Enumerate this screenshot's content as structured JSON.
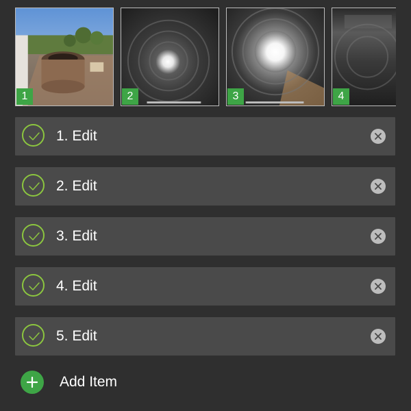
{
  "thumbnails": [
    {
      "number": "1",
      "icon": "rooftop-photo"
    },
    {
      "number": "2",
      "icon": "chimney-interior-photo"
    },
    {
      "number": "3",
      "icon": "chimney-interior-photo"
    },
    {
      "number": "4",
      "icon": "chimney-interior-photo"
    }
  ],
  "items": [
    {
      "label": "1. Edit",
      "status_icon": "check-circle-icon",
      "remove_icon": "close-circle-icon"
    },
    {
      "label": "2. Edit",
      "status_icon": "check-circle-icon",
      "remove_icon": "close-circle-icon"
    },
    {
      "label": "3. Edit",
      "status_icon": "check-circle-icon",
      "remove_icon": "close-circle-icon"
    },
    {
      "label": "4. Edit",
      "status_icon": "check-circle-icon",
      "remove_icon": "close-circle-icon"
    },
    {
      "label": "5. Edit",
      "status_icon": "check-circle-icon",
      "remove_icon": "close-circle-icon"
    }
  ],
  "add_item": {
    "label": "Add Item",
    "icon": "plus-circle-icon"
  },
  "colors": {
    "background": "#2f2f2f",
    "row_background": "#4a4a4a",
    "accent_green": "#3ea546",
    "check_green": "#8cc63f",
    "remove_gray": "#bdbdbd"
  }
}
